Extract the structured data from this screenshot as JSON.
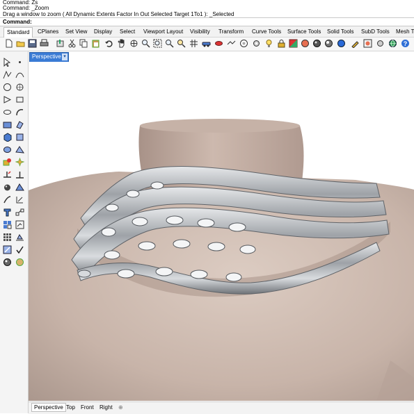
{
  "command_history": [
    "Command: Zs",
    "Command: _Zoom",
    "Drag a window to zoom ( All  Dynamic  Extents  Factor  In  Out  Selected  Target  1To1 ): _Selected"
  ],
  "command_prompt": "Command:",
  "toolbar_tabs": [
    "Standard",
    "CPlanes",
    "Set View",
    "Display",
    "Select",
    "Viewport Layout",
    "Visibility",
    "Transform",
    "Curve Tools",
    "Surface Tools",
    "Solid Tools",
    "SubD Tools",
    "Mesh Tools"
  ],
  "active_toolbar_tab": "Standard",
  "viewport": {
    "title": "Perspective",
    "menu_glyph": "▾"
  },
  "bottom_tabs": [
    "Perspective",
    "Top",
    "Front",
    "Right",
    "⊕"
  ],
  "toolbar_icons": [
    "new-icon",
    "open-icon",
    "save-icon",
    "print-icon",
    "import-icon",
    "cut-icon",
    "copy-icon",
    "paste-icon",
    "undo-icon",
    "pan-icon",
    "rotate-icon",
    "zoom-icon",
    "zoom-window-icon",
    "zoom-extents-icon",
    "zoom-selected-icon",
    "grid-icon",
    "car-icon",
    "line-icon",
    "circle-icon",
    "lightbulb-icon",
    "lock-icon",
    "color-icon",
    "shaded-icon",
    "rendered-icon",
    "sphere-icon",
    "options-icon",
    "render-icon",
    "globe-icon",
    "help-icon"
  ],
  "left_tool_icons": [
    "select-arrow-icon",
    "point-icon",
    "polyline-icon",
    "curve-icon",
    "circle-tool-icon",
    "arc-icon",
    "polygon-icon",
    "rectangle-icon",
    "ellipse-icon",
    "freeform-icon",
    "surface-icon",
    "extrude-icon",
    "solid-box-icon",
    "solid-tools-icon",
    "mesh-icon",
    "boolean-icon",
    "fillet-icon",
    "explode-icon",
    "trim-icon",
    "split-icon",
    "group-icon",
    "blend-icon",
    "text-icon",
    "dimension-icon",
    "transform-icon",
    "move-icon",
    "array-icon",
    "array-polar-icon",
    "box-icon",
    "check-icon",
    "analyze-icon",
    "render-tool-icon"
  ],
  "colors": {
    "accent": "#3a7bd5",
    "skin": "#c9b5ab",
    "metal": "#a9adb2"
  }
}
